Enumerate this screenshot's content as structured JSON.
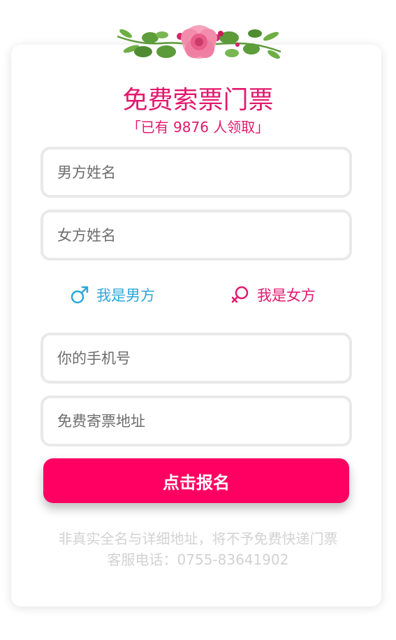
{
  "colors": {
    "accent": "#e3186e",
    "button": "#ff0062",
    "male": "#2aa7dc",
    "note": "#d2d2d2"
  },
  "header": {
    "title": "免费索票门票",
    "subtitle": "「已有 9876 人领取」"
  },
  "form": {
    "male_name_placeholder": "男方姓名",
    "female_name_placeholder": "女方姓名",
    "gender_male_label": "我是男方",
    "gender_female_label": "我是女方",
    "phone_placeholder": "你的手机号",
    "address_placeholder": "免费寄票地址",
    "submit_label": "点击报名"
  },
  "footer": {
    "note_line1": "非真实全名与详细地址，将不予免费快递门票",
    "note_line2": "客服电话：0755-83641902"
  },
  "icons": {
    "male": "male-symbol-icon",
    "female": "female-symbol-icon",
    "decoration": "flower-garland"
  }
}
